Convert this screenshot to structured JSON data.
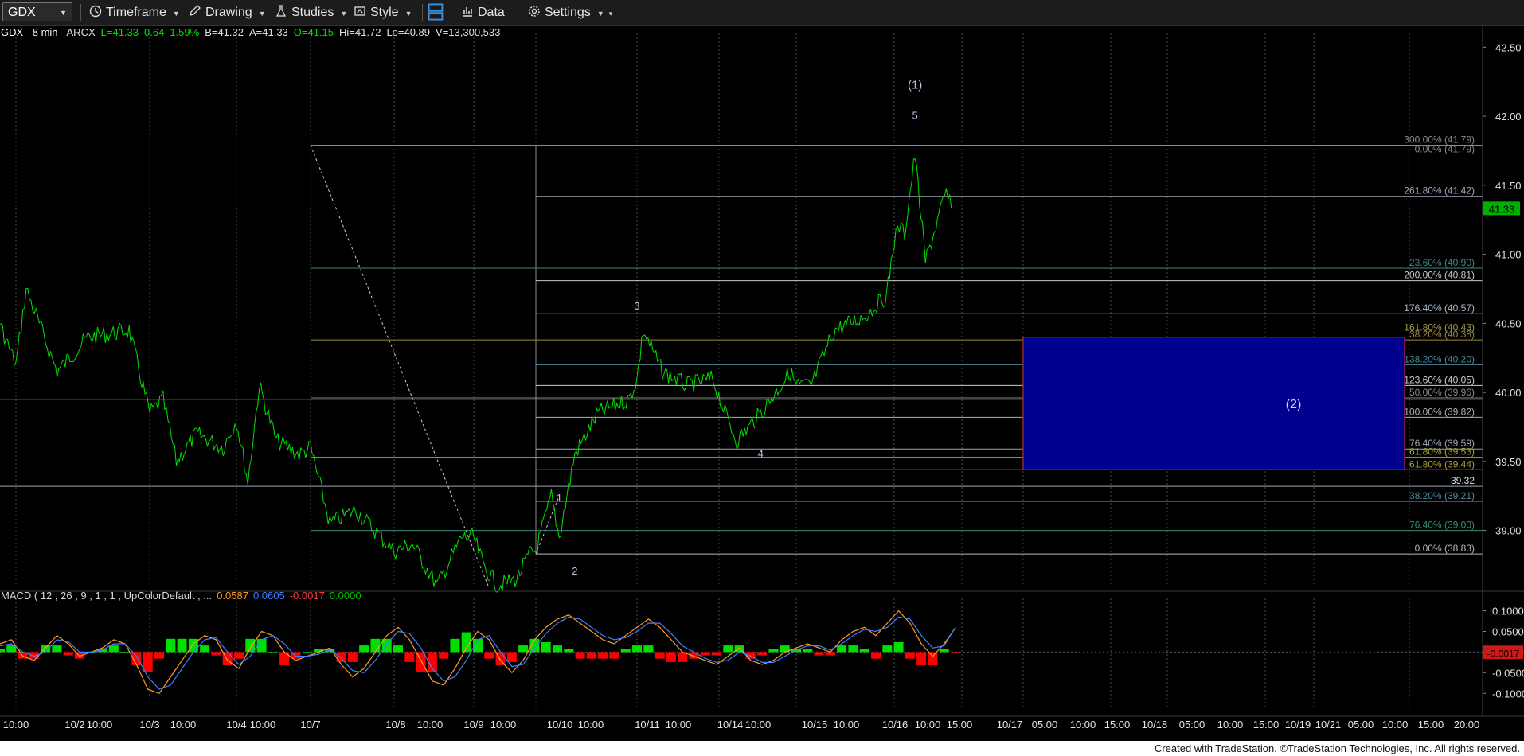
{
  "toolbar": {
    "symbol": "GDX",
    "timeframe": "Timeframe",
    "drawing": "Drawing",
    "studies": "Studies",
    "style": "Style",
    "data": "Data",
    "settings": "Settings"
  },
  "infoline": {
    "symbol": "GDX - 8 min",
    "exchange": "ARCX",
    "last": "L=41.33",
    "change": "0.64",
    "change_pct": "1.59%",
    "bid": "B=41.32",
    "ask": "A=41.33",
    "open": "O=41.15",
    "high": "Hi=41.72",
    "low": "Lo=40.89",
    "volume": "V=13,300,533"
  },
  "macd_panel": {
    "label": "MACD ( 12 , 26 , 9 , 1 , 1 , UpColorDefault , ...",
    "v1": "0.0587",
    "v2": "0.0605",
    "v3": "-0.0017",
    "v4": "0.0000",
    "colors": {
      "v1": "#ff9c2a",
      "v2": "#3f7fff",
      "v3": "#ff3a3a",
      "v4": "#00c000"
    }
  },
  "footer": "Created with TradeStation. ©TradeStation Technologies, Inc. All rights reserved.",
  "chart_data": [
    {
      "type": "line",
      "name": "GDX - 8 min price",
      "ylim": [
        38.6,
        42.6
      ],
      "y_ticks": [
        "42.50",
        "42.00",
        "41.50",
        "41.00",
        "40.50",
        "40.00",
        "39.50",
        "39.00"
      ],
      "y_tick_values": [
        42.5,
        42.0,
        41.5,
        41.0,
        40.5,
        40.0,
        39.5,
        39.0
      ],
      "x_labels": [
        "10:00",
        "10/2",
        "10:00",
        "10/3",
        "10:00",
        "10/4",
        "10:00",
        "10/7",
        "10/8",
        "10:00",
        "10/9",
        "10:00",
        "10/10",
        "10:00",
        "10/11",
        "10:00",
        "10/14",
        "10:00",
        "10/15",
        "10:00",
        "10/16",
        "10:00",
        "15:00",
        "10/17",
        "05:00",
        "10:00",
        "15:00",
        "10/18",
        "05:00",
        "10:00",
        "15:00",
        "10/19",
        "10/21",
        "05:00",
        "10:00",
        "15:00",
        "20:00"
      ],
      "series_color": "#00e000",
      "price_series": [
        {
          "x": "10/1 10:00",
          "y": 40.25
        },
        {
          "x": "10/1 11:30",
          "y": 40.65
        },
        {
          "x": "10/1 13:00",
          "y": 40.05
        },
        {
          "x": "10/1 14:30",
          "y": 40.5
        },
        {
          "x": "10/2 09:30",
          "y": 40.2
        },
        {
          "x": "10/2 10:00",
          "y": 40.75
        },
        {
          "x": "10/2 11:30",
          "y": 40.15
        },
        {
          "x": "10/2 13:00",
          "y": 40.4
        },
        {
          "x": "10/2 15:00",
          "y": 40.45
        },
        {
          "x": "10/3 09:30",
          "y": 39.85
        },
        {
          "x": "10/3 10:30",
          "y": 39.95
        },
        {
          "x": "10/3 11:30",
          "y": 39.5
        },
        {
          "x": "10/3 13:00",
          "y": 39.7
        },
        {
          "x": "10/3 15:00",
          "y": 39.6
        },
        {
          "x": "10/4 09:30",
          "y": 39.8
        },
        {
          "x": "10/4 10:30",
          "y": 39.35
        },
        {
          "x": "10/4 11:30",
          "y": 40.05
        },
        {
          "x": "10/4 13:00",
          "y": 39.65
        },
        {
          "x": "10/4 15:00",
          "y": 39.55
        },
        {
          "x": "10/7 09:30",
          "y": 39.6
        },
        {
          "x": "10/7 11:00",
          "y": 39.05
        },
        {
          "x": "10/7 13:00",
          "y": 39.15
        },
        {
          "x": "10/7 15:00",
          "y": 38.95
        },
        {
          "x": "10/8 09:30",
          "y": 38.85
        },
        {
          "x": "10/8 11:00",
          "y": 38.9
        },
        {
          "x": "10/8 13:00",
          "y": 38.6
        },
        {
          "x": "10/8 15:00",
          "y": 38.95
        },
        {
          "x": "10/9 09:30",
          "y": 38.95
        },
        {
          "x": "10/9 10:30",
          "y": 38.75
        },
        {
          "x": "10/9 12:00",
          "y": 38.6
        },
        {
          "x": "10/9 14:00",
          "y": 38.65
        },
        {
          "x": "10/9 15:30",
          "y": 38.85
        },
        {
          "x": "10/10 09:30",
          "y": 38.85
        },
        {
          "x": "10/10 10:30",
          "y": 39.25
        },
        {
          "x": "10/10 11:00",
          "y": 38.95
        },
        {
          "x": "10/10 12:00",
          "y": 39.55
        },
        {
          "x": "10/10 13:30",
          "y": 39.85
        },
        {
          "x": "10/10 15:30",
          "y": 39.95
        },
        {
          "x": "10/11 09:30",
          "y": 40.1
        },
        {
          "x": "10/11 10:00",
          "y": 40.45
        },
        {
          "x": "10/11 11:30",
          "y": 40.15
        },
        {
          "x": "10/11 13:30",
          "y": 40.05
        },
        {
          "x": "10/11 15:30",
          "y": 40.1
        },
        {
          "x": "10/14 10:00",
          "y": 39.85
        },
        {
          "x": "10/14 11:00",
          "y": 39.65
        },
        {
          "x": "10/14 13:00",
          "y": 39.85
        },
        {
          "x": "10/14 15:30",
          "y": 40.15
        },
        {
          "x": "10/15 09:30",
          "y": 40.05
        },
        {
          "x": "10/15 10:30",
          "y": 40.05
        },
        {
          "x": "10/15 12:00",
          "y": 40.45
        },
        {
          "x": "10/15 14:00",
          "y": 40.55
        },
        {
          "x": "10/15 15:30",
          "y": 40.7
        },
        {
          "x": "10/16 09:30",
          "y": 41.1
        },
        {
          "x": "10/16 10:00",
          "y": 41.2
        },
        {
          "x": "10/16 10:30",
          "y": 41.15
        },
        {
          "x": "10/16 11:30",
          "y": 41.72
        },
        {
          "x": "10/16 12:30",
          "y": 40.95
        },
        {
          "x": "10/16 13:30",
          "y": 41.2
        },
        {
          "x": "10/16 14:30",
          "y": 41.45
        },
        {
          "x": "10/16 15:00",
          "y": 41.33
        }
      ],
      "last_price": "41.33",
      "price_tag_color": "#00b000",
      "horizontal_levels": [
        {
          "value": 39.32,
          "label": "39.32",
          "color": "#9aa4b8"
        },
        {
          "value": 39.95,
          "label": "",
          "color": "#9aa4b8"
        }
      ],
      "fib_extension": {
        "anchor_x": "10/10 09:30",
        "levels": [
          {
            "value": 41.79,
            "label": "300.00% (41.79)",
            "color": "#8a8a8a"
          },
          {
            "value": 41.42,
            "label": "261.80% (41.42)",
            "color": "#9aa8b8"
          },
          {
            "value": 40.81,
            "label": "200.00% (40.81)",
            "color": "#c8c8c8"
          },
          {
            "value": 40.57,
            "label": "176.40% (40.57)",
            "color": "#a8b8c8"
          },
          {
            "value": 40.43,
            "label": "161.80% (40.43)",
            "color": "#a89a4a"
          },
          {
            "value": 40.2,
            "label": "138.20% (40.20)",
            "color": "#4a8aa0"
          },
          {
            "value": 40.05,
            "label": "123.60% (40.05)",
            "color": "#c8d0d8"
          },
          {
            "value": 39.82,
            "label": "100.00% (39.82)",
            "color": "#a8b0b8"
          },
          {
            "value": 39.59,
            "label": "76.40% (39.59)",
            "color": "#9aa8b8"
          },
          {
            "value": 38.83,
            "label": "0.00% (38.83)",
            "color": "#b8b8b8"
          }
        ]
      },
      "fib_retracement": {
        "anchor_x": "10/7 09:30",
        "levels": [
          {
            "value": 41.79,
            "label": "0.00% (41.79)",
            "color": "#8a8a8a"
          },
          {
            "value": 40.9,
            "label": "23.60% (40.90)",
            "color": "#3a8a8a"
          },
          {
            "value": 40.38,
            "label": "38.20% (40.38)",
            "color": "#9a8a3a"
          },
          {
            "value": 39.96,
            "label": "50.00% (39.96)",
            "color": "#8a8a8a"
          },
          {
            "value": 39.53,
            "label": "61.80% (39.53)",
            "color": "#a8a040"
          },
          {
            "value": 39.0,
            "label": "76.40% (39.00)",
            "color": "#3a8a7a"
          }
        ]
      },
      "fib_small": {
        "anchor_x": "10/10 09:30",
        "levels": [
          {
            "value": 39.44,
            "label": "61.80% (39.44)",
            "color": "#a8a040"
          },
          {
            "value": 39.21,
            "label": "38.20% (39.21)",
            "color": "#4a8aa0"
          }
        ]
      },
      "target_box": {
        "x_start": "10/17 04:00",
        "x_end": "10/19 00:00",
        "y_top": 40.4,
        "y_bottom": 39.44,
        "label": "(2)",
        "color": "#00008e",
        "border": "#c0302a"
      },
      "wave_labels": [
        {
          "text": "(1)",
          "x": "10/16 11:30",
          "y": 42.2
        },
        {
          "text": "5",
          "x": "10/16 11:30",
          "y": 41.98
        },
        {
          "text": "3",
          "x": "10/11 09:30",
          "y": 40.6
        },
        {
          "text": "4",
          "x": "10/14 13:00",
          "y": 39.53
        },
        {
          "text": "1",
          "x": "10/10 11:00",
          "y": 39.21
        },
        {
          "text": "2",
          "x": "10/10 12:00",
          "y": 38.68
        }
      ],
      "grid": true
    },
    {
      "type": "bar",
      "name": "MACD ( 12 , 26 , 9 , 1 , 1 , UpColorDefault , ...",
      "ylim": [
        -0.14,
        0.13
      ],
      "y_ticks": [
        "0.1000",
        "0.0500",
        "0.0000",
        "-0.0500",
        "-0.1000"
      ],
      "y_tick_values": [
        0.1,
        0.05,
        0.0,
        -0.05,
        -0.1
      ],
      "last_value_tag": "-0.0017",
      "up_color": "#00e000",
      "down_color": "#ff0000",
      "series": [
        {
          "name": "MACD",
          "color": "#ff9c2a"
        },
        {
          "name": "Signal",
          "color": "#3f7fff"
        }
      ],
      "macd_values": [
        0.02,
        0.03,
        -0.01,
        -0.02,
        0.01,
        0.04,
        0.02,
        -0.01,
        0.0,
        0.01,
        0.03,
        0.02,
        -0.03,
        -0.09,
        -0.1,
        -0.06,
        -0.02,
        0.02,
        0.04,
        0.03,
        -0.02,
        -0.04,
        0.01,
        0.05,
        0.04,
        0.0,
        -0.02,
        -0.01,
        0.0,
        0.01,
        -0.03,
        -0.06,
        -0.04,
        0.0,
        0.04,
        0.06,
        0.03,
        -0.02,
        -0.07,
        -0.08,
        -0.04,
        0.01,
        0.05,
        0.03,
        -0.02,
        -0.05,
        -0.02,
        0.03,
        0.06,
        0.08,
        0.09,
        0.07,
        0.05,
        0.03,
        0.02,
        0.04,
        0.06,
        0.08,
        0.06,
        0.03,
        0.0,
        -0.01,
        -0.02,
        -0.03,
        -0.01,
        0.01,
        -0.02,
        -0.03,
        -0.02,
        0.0,
        0.01,
        0.02,
        0.01,
        0.0,
        0.03,
        0.05,
        0.06,
        0.04,
        0.07,
        0.1,
        0.07,
        0.02,
        -0.01,
        0.02,
        0.0587
      ],
      "signal_values": [
        0.015,
        0.02,
        0.0,
        -0.01,
        0.0,
        0.03,
        0.025,
        0.0,
        0.0,
        0.005,
        0.02,
        0.02,
        -0.01,
        -0.06,
        -0.09,
        -0.08,
        -0.04,
        0.0,
        0.03,
        0.035,
        0.0,
        -0.03,
        -0.01,
        0.03,
        0.04,
        0.02,
        -0.01,
        -0.01,
        -0.005,
        0.005,
        -0.015,
        -0.045,
        -0.05,
        -0.02,
        0.02,
        0.05,
        0.045,
        0.01,
        -0.04,
        -0.07,
        -0.06,
        -0.02,
        0.03,
        0.04,
        0.0,
        -0.035,
        -0.03,
        0.01,
        0.045,
        0.07,
        0.085,
        0.08,
        0.06,
        0.04,
        0.03,
        0.035,
        0.05,
        0.07,
        0.07,
        0.045,
        0.015,
        0.0,
        -0.015,
        -0.025,
        -0.02,
        0.0,
        -0.01,
        -0.025,
        -0.025,
        -0.01,
        0.005,
        0.015,
        0.015,
        0.005,
        0.02,
        0.04,
        0.055,
        0.05,
        0.06,
        0.085,
        0.08,
        0.04,
        0.01,
        0.015,
        0.0605
      ]
    }
  ]
}
